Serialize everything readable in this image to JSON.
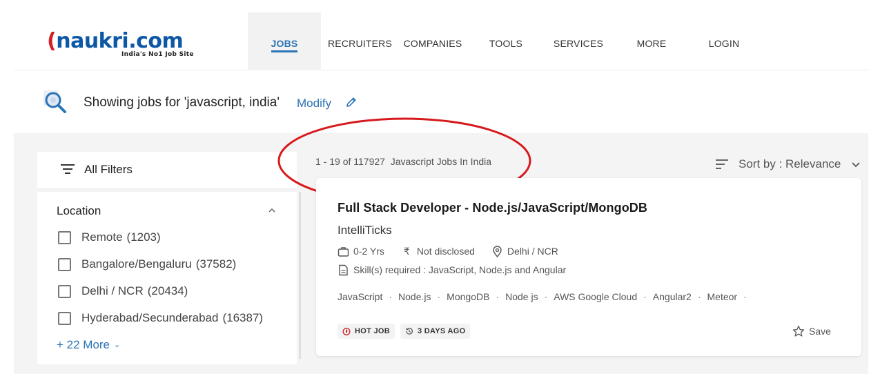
{
  "brand": {
    "logo_text": "naukri.com",
    "tagline": "India's No1 Job Site",
    "primary_color": "#0d58a6",
    "accent_color": "#d21f26"
  },
  "nav": {
    "items": [
      "JOBS",
      "RECRUITERS",
      "COMPANIES",
      "TOOLS",
      "SERVICES",
      "MORE",
      "LOGIN"
    ],
    "active": "JOBS"
  },
  "search": {
    "summary": "Showing jobs for 'javascript, india'",
    "modify_label": "Modify",
    "icon": "search-magnifier-icon"
  },
  "filters": {
    "title": "All Filters",
    "location": {
      "title": "Location",
      "options": [
        {
          "label": "Remote",
          "count": "(1203)",
          "checked": false
        },
        {
          "label": "Bangalore/Bengaluru",
          "count": "(37582)",
          "checked": false
        },
        {
          "label": "Delhi / NCR",
          "count": "(20434)",
          "checked": false
        },
        {
          "label": "Hyderabad/Secunderabad",
          "count": "(16387)",
          "checked": false
        }
      ],
      "more_label": "+ 22 More"
    }
  },
  "results": {
    "count_text": "1 - 19 of 117927",
    "query_text": "Javascript Jobs In India",
    "sort_label": "Sort by : Relevance",
    "highlight_color": "#d7191c"
  },
  "job": {
    "title": "Full Stack Developer - Node.js/JavaScript/MongoDB",
    "company": "IntelliTicks",
    "experience": "0-2 Yrs",
    "salary": "Not disclosed",
    "location": "Delhi / NCR",
    "skills_required": "Skill(s) required : JavaScript, Node.js and Angular",
    "tags": [
      "JavaScript",
      "Node.js",
      "MongoDB",
      "Node js",
      "AWS Google Cloud",
      "Angular2",
      "Meteor"
    ],
    "badges": {
      "hot": "HOT JOB",
      "age": "3 DAYS AGO"
    },
    "save_label": "Save"
  }
}
